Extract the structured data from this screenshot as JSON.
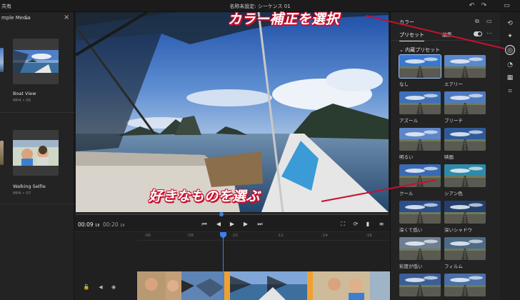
{
  "topbar": {
    "share_label": "共有",
    "doc_title": "名称未設定: シーケンス 01"
  },
  "media_panel": {
    "dropdown_label": "mple Media",
    "items": [
      {
        "name": "Boat View",
        "meta": "MP4 • 05"
      },
      {
        "name": "Walking Selfie",
        "meta": "MP4 • 07"
      }
    ]
  },
  "transport": {
    "current_time": "00:09",
    "current_frames": "18",
    "total_time": "00:20",
    "total_frames": "18"
  },
  "timeline": {
    "ticks": [
      ":06",
      ":08",
      ":10",
      ":12",
      ":14",
      ":16"
    ]
  },
  "color_panel": {
    "title": "カラー",
    "tab_presets": "プリセット",
    "tab_edit": "編集",
    "section_label": "内蔵プリセット",
    "presets": [
      {
        "label": "なし",
        "selected": true
      },
      {
        "label": "エアリー"
      },
      {
        "label": "アズール"
      },
      {
        "label": "ブリーチ"
      },
      {
        "label": "明るい"
      },
      {
        "label": "映画"
      },
      {
        "label": "クール"
      },
      {
        "label": "シアン色"
      },
      {
        "label": "深くて低い"
      },
      {
        "label": "深いシャドウ"
      },
      {
        "label": "彩度が低い"
      },
      {
        "label": "フィルム"
      },
      {
        "label": ""
      },
      {
        "label": ""
      }
    ]
  },
  "annotations": {
    "top": "カラー補正を選択",
    "middle": "好きなものを選ぶ"
  },
  "colors": {
    "accent_blue": "#3b7ff0",
    "annotation_red": "#c8102e",
    "clip_orange": "#f0a030"
  },
  "icons": {
    "close": "close-icon",
    "dropdown": "chevron-down-icon",
    "color": "color-icon"
  }
}
